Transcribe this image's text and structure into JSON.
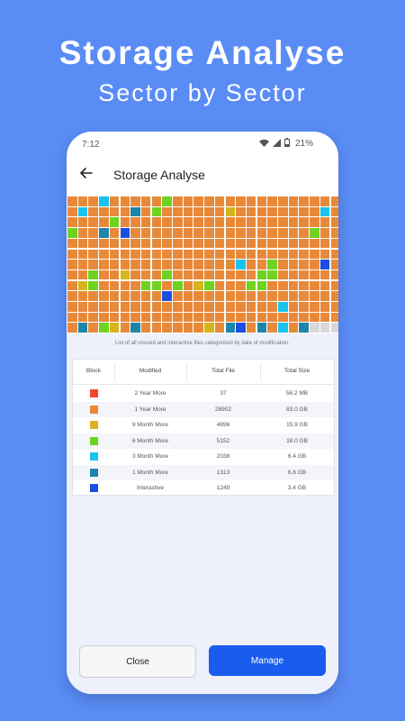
{
  "promo": {
    "headline": "Storage Analyse",
    "subheadline": "Sector by Sector"
  },
  "status_bar": {
    "time": "7:12",
    "battery": "21%",
    "icons": [
      "wifi-icon",
      "signal-icon",
      "battery-icon"
    ]
  },
  "app_bar": {
    "title": "Storage Analyse",
    "back_icon": "arrow-left-icon"
  },
  "colors": {
    "a": "#e8893a",
    "b": "#19c3f0",
    "c": "#6ed21f",
    "d": "#d6b51c",
    "e": "#1d85a8",
    "f": "#1b4fe0",
    "g": "#d8d8d8",
    "r": "#f24530"
  },
  "sector_grid": {
    "rows": [
      "aaabaaaaacaaaaaaaaaaaaaaaaaaaaaaaa",
      "abaaaaeacaaaaaadaaaaaaaabaacaaaaac",
      "aaaacaaaaaaaaaaaaaaaaaaaaaabcaaaae",
      "caaeafaaaaaaaaaaaaaaaaacaaaaaaaaac",
      "aaaaaaaaaaaaaaaaaaaaaaaaaaaaaaaaaa",
      "aaaaaaaaaaaaaaaaaaaaaaaaaaaaaaaaaa",
      "aaaaaaaaaaaaaaaabaacaaaafaaaaaaaab",
      "aacaadaaacaaaaaaaaccaaaaaaaaaaaaac",
      "adcaaaaccacadcaaaccaaaaaaacaaaaaac",
      "aaaaaaaaafaaaaaaaaaaaaaaaaaaaaaaad",
      "aaaaaaaaaaaaaaaaaaaabaaaaaaaaaaaac",
      "aaaaaaaaaaaaaaaaaaaaaaaaaaaaaaaaaa",
      "aeacdaeaaaaaadaefaeabaeggggggggggg"
    ]
  },
  "caption": "List of all unused and interactive files categorized by date of modification.",
  "table": {
    "headers": [
      "Block",
      "Modified",
      "Total File",
      "Total Size"
    ],
    "rows": [
      {
        "color": "#f24530",
        "modified": "2 Year More",
        "files": "37",
        "size": "58.2 MB"
      },
      {
        "color": "#e8893a",
        "modified": "1 Year More",
        "files": "28902",
        "size": "83.0 GB"
      },
      {
        "color": "#d6b51c",
        "modified": "9 Month More",
        "files": "4896",
        "size": "15.9 GB"
      },
      {
        "color": "#6ed21f",
        "modified": "6 Month More",
        "files": "5152",
        "size": "18.0 GB"
      },
      {
        "color": "#19c3f0",
        "modified": "3 Month More",
        "files": "2038",
        "size": "6.4 GB"
      },
      {
        "color": "#1d85a8",
        "modified": "1 Month More",
        "files": "1313",
        "size": "6.6 GB"
      },
      {
        "color": "#1b4fe0",
        "modified": "Interactive",
        "files": "1249",
        "size": "3.4 GB"
      }
    ]
  },
  "buttons": {
    "close": "Close",
    "manage": "Manage"
  }
}
